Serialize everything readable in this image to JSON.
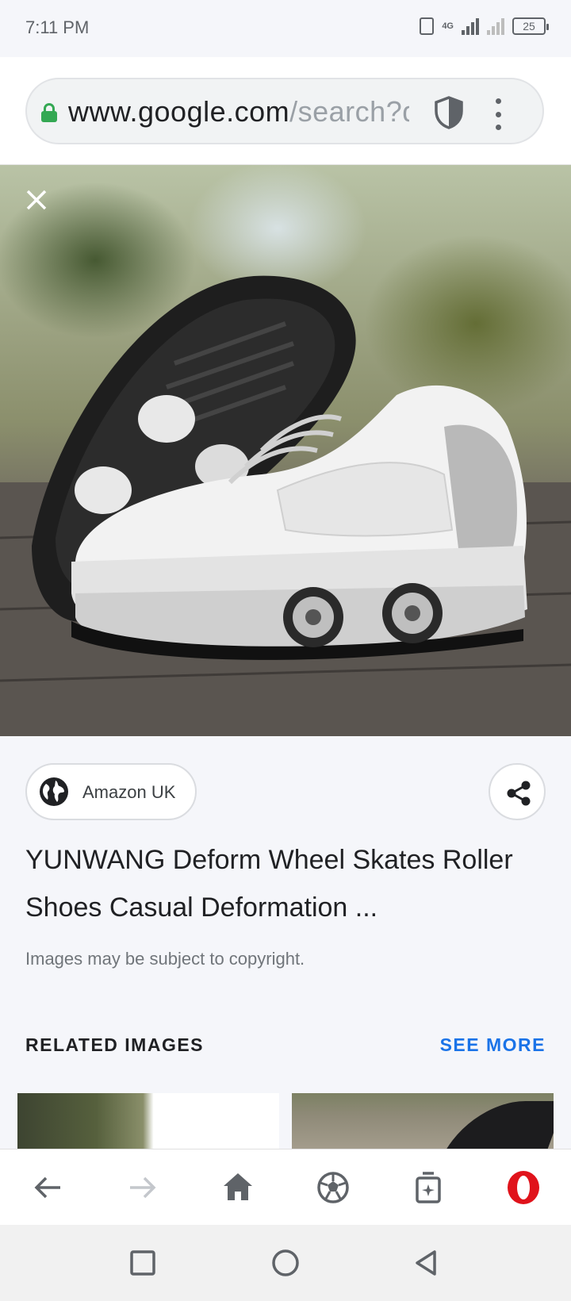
{
  "status_bar": {
    "time": "7:11 PM",
    "network": "4G",
    "battery": "25"
  },
  "url_bar": {
    "host": "www.google.com",
    "path": "/search?q"
  },
  "result": {
    "source": "Amazon UK",
    "title": "YUNWANG Deform Wheel Skates Roller Shoes Casual Deformation ...",
    "copyright_note": "Images may be subject to copyright."
  },
  "related": {
    "heading": "RELATED IMAGES",
    "see_more": "SEE MORE"
  },
  "colors": {
    "accent_blue": "#1a73e8",
    "lock_green": "#34a853",
    "opera_red": "#e0131b"
  },
  "icons": {
    "close": "close-icon",
    "share": "share-icon",
    "globe": "globe-icon",
    "back": "arrow-back-icon",
    "forward": "arrow-forward-icon",
    "home": "home-icon",
    "speed_dial": "soccer-ball-icon",
    "tabs": "tabs-icon",
    "menu": "opera-logo-icon"
  }
}
